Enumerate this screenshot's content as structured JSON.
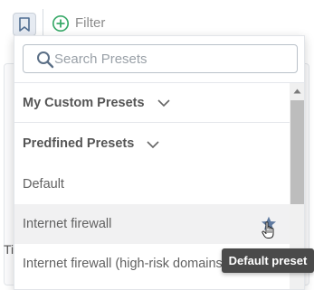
{
  "toolbar": {
    "filter_label": "Filter"
  },
  "background": {
    "partial_text": "Ti"
  },
  "presets_dropdown": {
    "search_placeholder": "Search Presets",
    "groups": [
      {
        "label": "My Custom Presets"
      },
      {
        "label": "Predfined Presets"
      }
    ],
    "items": [
      {
        "label": "Default"
      },
      {
        "label": "Internet firewall",
        "hovered": true
      },
      {
        "label": "Internet firewall (high-risk domains)"
      }
    ]
  },
  "tooltip": {
    "text": "Default preset"
  },
  "colors": {
    "accent_green": "#3aaa6a",
    "star_icon": "#5f7aa0",
    "tooltip_bg": "#4a4a4a"
  }
}
